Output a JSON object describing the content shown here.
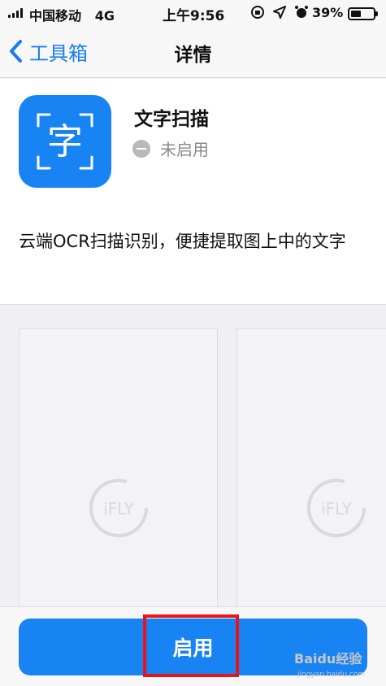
{
  "status_bar": {
    "carrier": "中国移动",
    "network": "4G",
    "time": "上午9:56",
    "battery_percent": "39%",
    "battery_level": 0.39
  },
  "nav": {
    "back_label": "工具箱",
    "title": "详情"
  },
  "app": {
    "icon_glyph": "字",
    "name": "文字扫描",
    "status": "未启用",
    "description": "云端OCR扫描识别，便捷提取图上中的文字"
  },
  "screenshots": {
    "logo_text": "iFLY"
  },
  "footer": {
    "enable_label": "启用",
    "watermark": "Baidu经验",
    "watermark_sub": "jingyan.baidu.com"
  },
  "colors": {
    "accent": "#1883f2",
    "back_blue": "#1a7cf4",
    "highlight": "#e8141c"
  }
}
